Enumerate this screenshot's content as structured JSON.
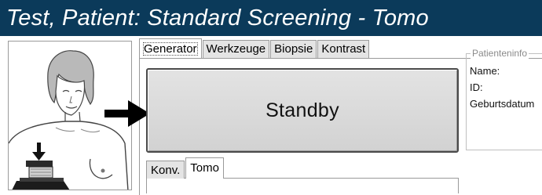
{
  "window": {
    "title": "Test, Patient:  Standard Screening - Tomo"
  },
  "tabs": [
    {
      "label": "Generator",
      "active": true
    },
    {
      "label": "Werkzeuge",
      "active": false
    },
    {
      "label": "Biopsie",
      "active": false
    },
    {
      "label": "Kontrast",
      "active": false
    }
  ],
  "generator": {
    "status_button_label": "Standby"
  },
  "patient_info": {
    "legend": "Patienteninfo",
    "name_label": "Name:",
    "id_label": "ID:",
    "birthdate_label": "Geburtsdatum"
  },
  "mode_tabs": [
    {
      "label": "Konv.",
      "active": false
    },
    {
      "label": "Tomo",
      "active": true
    }
  ],
  "icons": {
    "patient_image": "patient-compression-icon",
    "arrow": "right-arrow-icon"
  },
  "colors": {
    "titlebar_bg": "#0b3a5a",
    "titlebar_text": "#ffffff"
  }
}
